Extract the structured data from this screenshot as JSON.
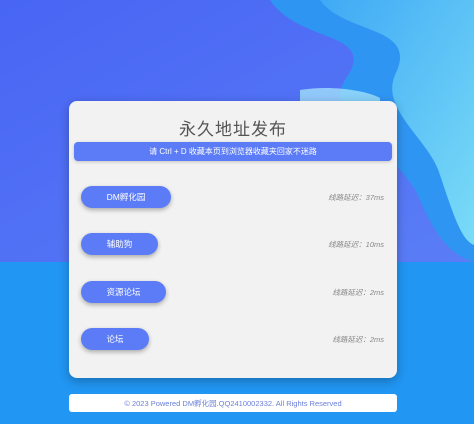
{
  "title": "永久地址发布",
  "notice": "请 Ctrl + D 收藏本页到浏览器收藏夹回家不迷路",
  "links": [
    {
      "label": "DM孵化园",
      "latency": "线路延迟：37ms"
    },
    {
      "label": "辅助狗",
      "latency": "线路延迟：10ms"
    },
    {
      "label": "资源论坛",
      "latency": "线路延迟：2ms"
    },
    {
      "label": "论坛",
      "latency": "线路延迟：2ms"
    }
  ],
  "footer": "© 2023 Powered DM孵化园.QQ2410002332. All Rights Reserved",
  "colors": {
    "background_bottom": "#2196f3",
    "background_top": "#4f6df5",
    "wave_light": "#6fd0f5",
    "button": "#5b7cf6",
    "card": "#f2f2f2"
  }
}
